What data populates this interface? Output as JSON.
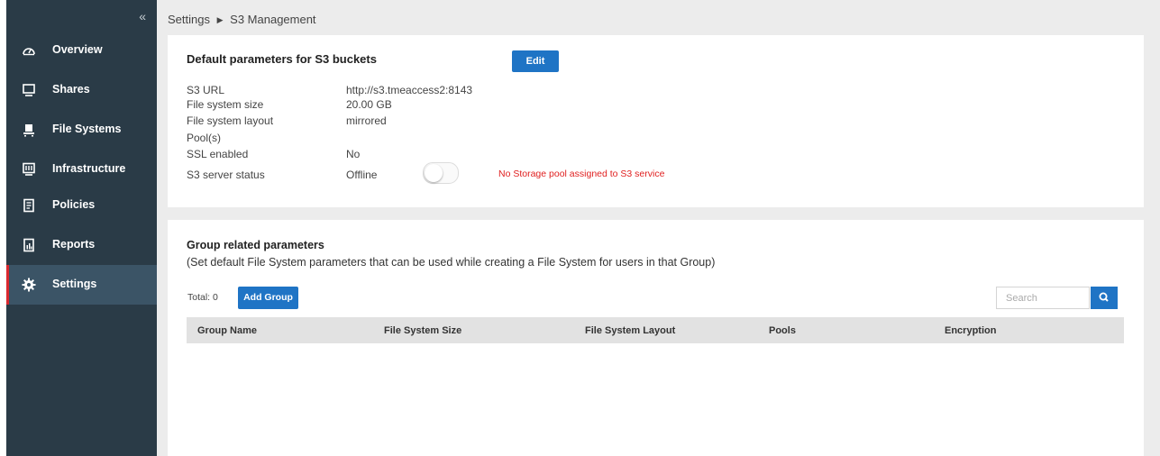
{
  "sidebar": {
    "collapse_glyph": "«",
    "items": [
      {
        "label": "Overview",
        "icon": "dashboard-icon"
      },
      {
        "label": "Shares",
        "icon": "monitor-icon"
      },
      {
        "label": "File Systems",
        "icon": "file-systems-icon"
      },
      {
        "label": "Infrastructure",
        "icon": "server-icon"
      },
      {
        "label": "Policies",
        "icon": "document-icon"
      },
      {
        "label": "Reports",
        "icon": "report-icon"
      },
      {
        "label": "Settings",
        "icon": "gear-icon",
        "active": true
      }
    ]
  },
  "breadcrumb": {
    "parent": "Settings",
    "separator": "▶",
    "current": "S3 Management"
  },
  "defaults_card": {
    "title": "Default parameters for S3 buckets",
    "edit_label": "Edit",
    "fields": [
      {
        "label": "S3 URL",
        "value": "http://s3.tmeaccess2:8143"
      },
      {
        "label": "File system size",
        "value": "20.00 GB"
      },
      {
        "label": "File system layout",
        "value": "mirrored"
      },
      {
        "label": "Pool(s)",
        "value": ""
      },
      {
        "label": "SSL enabled",
        "value": "No"
      },
      {
        "label": "S3 server status",
        "value": "Offline"
      }
    ],
    "server_toggle_on": false,
    "warning": "No Storage pool assigned to S3 service"
  },
  "group_card": {
    "title": "Group related parameters",
    "subtitle": "(Set default File System parameters that can be used while creating a File System for users in that Group)",
    "total_label": "Total: 0",
    "add_group_label": "Add Group",
    "search_placeholder": "Search",
    "columns": [
      "Group Name",
      "File System Size",
      "File System Layout",
      "Pools",
      "Encryption"
    ],
    "rows": []
  },
  "colors": {
    "sidebar_bg": "#2a3b47",
    "active_item_bg": "#3b5466",
    "active_marker": "#d9282f",
    "primary_button": "#1f74c5",
    "warning_text": "#e02020"
  }
}
